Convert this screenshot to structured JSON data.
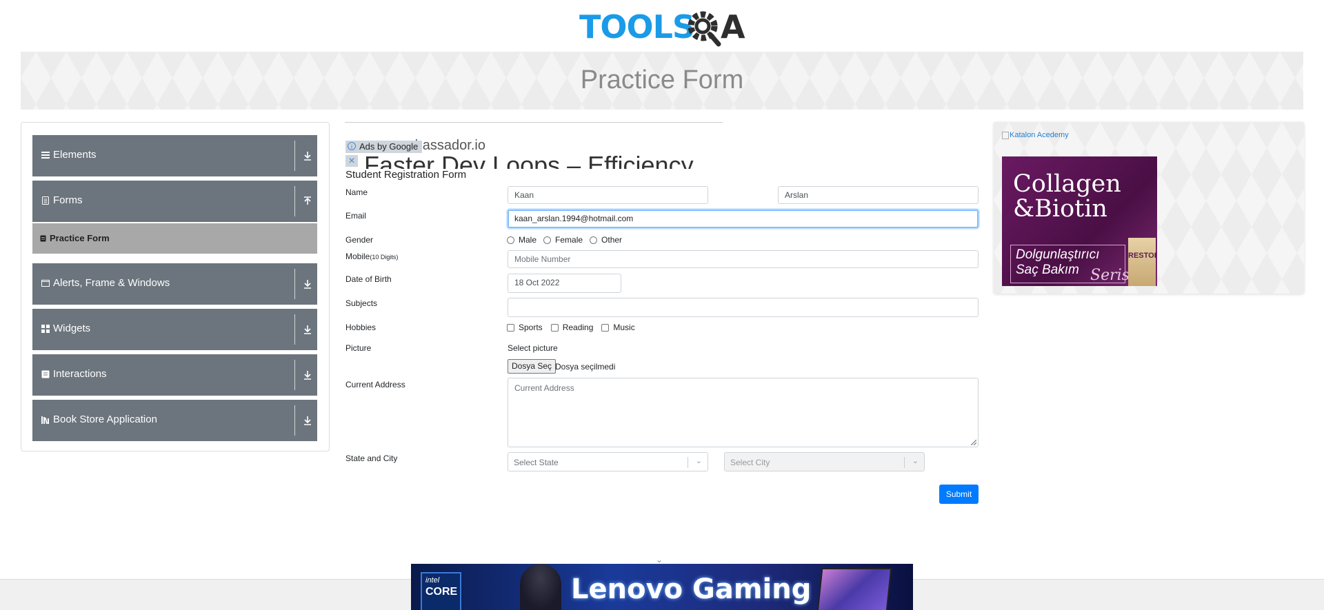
{
  "logo": {
    "text_tools": "TOOLS",
    "text_a": "A"
  },
  "page_title": "Practice Form",
  "sidebar": {
    "groups": [
      {
        "label": "Elements",
        "icon": "hamburger-icon"
      },
      {
        "label": "Forms",
        "icon": "document-icon"
      },
      {
        "label": "Alerts, Frame & Windows",
        "icon": "window-icon"
      },
      {
        "label": "Widgets",
        "icon": "grid-icon"
      },
      {
        "label": "Interactions",
        "icon": "interaction-icon"
      },
      {
        "label": "Book Store Application",
        "icon": "books-icon"
      }
    ],
    "active_item": "Practice Form"
  },
  "ad_top": {
    "site": "mbassador.io",
    "headline": "Faster Dev Loops – Efficiency",
    "ads_by": "Ads by Google"
  },
  "form": {
    "title": "Student Registration Form",
    "labels": {
      "name": "Name",
      "email": "Email",
      "gender": "Gender",
      "mobile": "Mobile",
      "mobile_hint": "(10 Digits)",
      "dob": "Date of Birth",
      "subjects": "Subjects",
      "hobbies": "Hobbies",
      "picture": "Picture",
      "address": "Current Address",
      "state_city": "State and City"
    },
    "first_name": "Kaan",
    "last_name": "Arslan",
    "email": "kaan_arslan.1994@hotmail.com",
    "genders": [
      "Male",
      "Female",
      "Other"
    ],
    "mobile_placeholder": "Mobile Number",
    "dob": "18 Oct 2022",
    "subjects": "",
    "hobbies": [
      "Sports",
      "Reading",
      "Music"
    ],
    "picture_label": "Select picture",
    "file_button": "Dosya Seç",
    "file_status": "Dosya seçilmedi",
    "address_placeholder": "Current Address",
    "state_placeholder": "Select State",
    "city_placeholder": "Select City",
    "submit": "Submit"
  },
  "right_ad": {
    "katalon": "Katalon Acedemy",
    "line1": "Collagen",
    "line2": "&Biotin",
    "line3": "Dolgunlaştırıcı",
    "line4": "Saç Bakım",
    "line5": "Serisi",
    "product": "RESTORE"
  },
  "bottom_ad": {
    "brand": "Lenovo Gaming",
    "intel_1": "intel",
    "intel_2": "CORE"
  },
  "colors": {
    "sidebar_group": "#6c757d",
    "active_item": "#a8a8a8",
    "primary": "#007bff",
    "logo_blue": "#1a9be8"
  }
}
